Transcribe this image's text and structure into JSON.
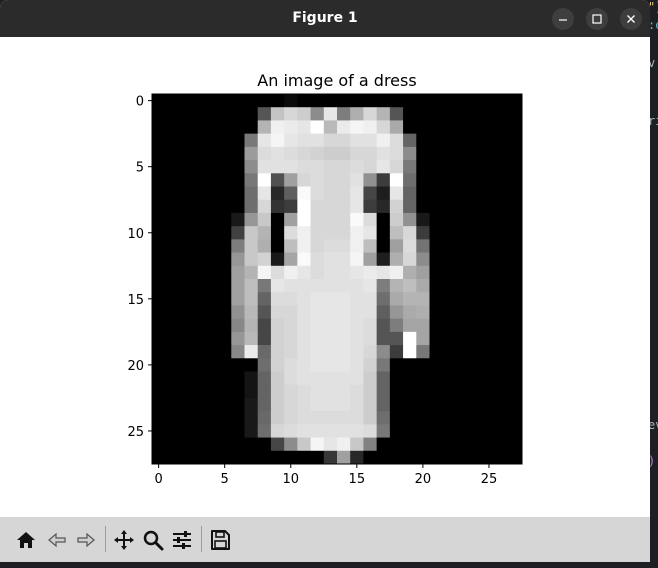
{
  "window": {
    "title": "Figure 1"
  },
  "background_fragments": [
    "\")",
    ":e",
    "v",
    "ri",
    "ev",
    ")"
  ],
  "figure": {
    "chart_data": {
      "type": "heatmap",
      "title": "An image of a dress",
      "colormap": "gray",
      "xlim": [
        -0.5,
        27.5
      ],
      "ylim": [
        27.5,
        -0.5
      ],
      "xticks": [
        0,
        5,
        10,
        15,
        20,
        25
      ],
      "yticks": [
        0,
        5,
        10,
        15,
        20,
        25
      ],
      "rows": [
        [
          0,
          0,
          0,
          0,
          0,
          0,
          0,
          0,
          0,
          0,
          10,
          0,
          0,
          0,
          0,
          0,
          0,
          0,
          0,
          0,
          0,
          0,
          0,
          0,
          0,
          0,
          0,
          0
        ],
        [
          0,
          0,
          0,
          0,
          0,
          0,
          0,
          0,
          85,
          195,
          215,
          205,
          140,
          230,
          125,
          175,
          215,
          180,
          85,
          0,
          0,
          0,
          0,
          0,
          0,
          0,
          0,
          0
        ],
        [
          0,
          0,
          0,
          0,
          0,
          0,
          0,
          0,
          180,
          240,
          235,
          230,
          255,
          185,
          235,
          245,
          240,
          215,
          170,
          0,
          0,
          0,
          0,
          0,
          0,
          0,
          0,
          0
        ],
        [
          0,
          0,
          0,
          0,
          0,
          0,
          0,
          120,
          230,
          245,
          230,
          225,
          225,
          215,
          215,
          225,
          225,
          240,
          220,
          100,
          0,
          0,
          0,
          0,
          0,
          0,
          0,
          0
        ],
        [
          0,
          0,
          0,
          0,
          0,
          0,
          0,
          155,
          220,
          225,
          220,
          215,
          210,
          205,
          205,
          215,
          215,
          225,
          220,
          140,
          0,
          0,
          0,
          0,
          0,
          0,
          0,
          0
        ],
        [
          0,
          0,
          0,
          0,
          0,
          0,
          0,
          140,
          225,
          225,
          225,
          220,
          220,
          215,
          215,
          220,
          215,
          230,
          215,
          120,
          0,
          0,
          0,
          0,
          0,
          0,
          0,
          0
        ],
        [
          0,
          0,
          0,
          0,
          0,
          0,
          0,
          120,
          255,
          80,
          160,
          215,
          220,
          215,
          215,
          225,
          145,
          60,
          255,
          110,
          0,
          0,
          0,
          0,
          0,
          0,
          0,
          0
        ],
        [
          0,
          0,
          0,
          0,
          0,
          0,
          0,
          110,
          230,
          40,
          95,
          250,
          220,
          215,
          215,
          230,
          70,
          30,
          230,
          100,
          0,
          0,
          0,
          0,
          0,
          0,
          0,
          0
        ],
        [
          0,
          0,
          0,
          0,
          0,
          0,
          0,
          110,
          215,
          50,
          60,
          255,
          215,
          215,
          215,
          230,
          60,
          40,
          210,
          100,
          0,
          0,
          0,
          0,
          0,
          0,
          0,
          0
        ],
        [
          0,
          0,
          0,
          0,
          0,
          0,
          25,
          150,
          200,
          0,
          160,
          255,
          215,
          215,
          215,
          250,
          220,
          0,
          205,
          145,
          25,
          0,
          0,
          0,
          0,
          0,
          0,
          0
        ],
        [
          0,
          0,
          0,
          0,
          0,
          0,
          65,
          200,
          180,
          0,
          220,
          240,
          215,
          215,
          215,
          240,
          230,
          0,
          190,
          215,
          60,
          0,
          0,
          0,
          0,
          0,
          0,
          0
        ],
        [
          0,
          0,
          0,
          0,
          0,
          0,
          125,
          200,
          175,
          0,
          190,
          240,
          215,
          220,
          220,
          240,
          190,
          0,
          160,
          220,
          115,
          0,
          0,
          0,
          0,
          0,
          0,
          0
        ],
        [
          0,
          0,
          0,
          0,
          0,
          0,
          150,
          200,
          210,
          25,
          165,
          250,
          220,
          225,
          225,
          245,
          160,
          30,
          175,
          215,
          140,
          0,
          0,
          0,
          0,
          0,
          0,
          0
        ],
        [
          0,
          0,
          0,
          0,
          0,
          0,
          160,
          180,
          245,
          220,
          240,
          230,
          220,
          225,
          225,
          230,
          235,
          230,
          240,
          175,
          160,
          0,
          0,
          0,
          0,
          0,
          0,
          0
        ],
        [
          0,
          0,
          0,
          0,
          0,
          0,
          160,
          190,
          120,
          230,
          225,
          225,
          225,
          225,
          225,
          225,
          230,
          125,
          180,
          190,
          170,
          0,
          0,
          0,
          0,
          0,
          0,
          0
        ],
        [
          0,
          0,
          0,
          0,
          0,
          0,
          160,
          190,
          100,
          220,
          220,
          225,
          230,
          230,
          230,
          225,
          225,
          110,
          170,
          180,
          180,
          0,
          0,
          0,
          0,
          0,
          0,
          0
        ],
        [
          0,
          0,
          0,
          0,
          0,
          0,
          145,
          185,
          85,
          215,
          215,
          225,
          230,
          230,
          230,
          225,
          225,
          95,
          150,
          170,
          175,
          0,
          0,
          0,
          0,
          0,
          0,
          0
        ],
        [
          0,
          0,
          0,
          0,
          0,
          0,
          135,
          180,
          70,
          210,
          215,
          225,
          230,
          230,
          230,
          225,
          220,
          85,
          125,
          165,
          165,
          0,
          0,
          0,
          0,
          0,
          0,
          0
        ],
        [
          0,
          0,
          0,
          0,
          0,
          0,
          150,
          185,
          70,
          210,
          215,
          225,
          230,
          230,
          230,
          225,
          220,
          85,
          85,
          255,
          165,
          0,
          0,
          0,
          0,
          0,
          0,
          0
        ],
        [
          0,
          0,
          0,
          0,
          0,
          0,
          135,
          235,
          105,
          210,
          215,
          225,
          230,
          230,
          230,
          225,
          215,
          140,
          60,
          255,
          120,
          0,
          0,
          0,
          0,
          0,
          0,
          0
        ],
        [
          0,
          0,
          0,
          0,
          0,
          0,
          0,
          0,
          110,
          210,
          220,
          225,
          230,
          230,
          230,
          225,
          210,
          120,
          0,
          0,
          0,
          0,
          0,
          0,
          0,
          0,
          0,
          0
        ],
        [
          0,
          0,
          0,
          0,
          0,
          0,
          0,
          20,
          100,
          205,
          220,
          225,
          225,
          225,
          225,
          225,
          205,
          100,
          0,
          0,
          0,
          0,
          0,
          0,
          0,
          0,
          0,
          0
        ],
        [
          0,
          0,
          0,
          0,
          0,
          0,
          0,
          20,
          100,
          205,
          215,
          220,
          225,
          225,
          225,
          220,
          205,
          100,
          0,
          0,
          0,
          0,
          0,
          0,
          0,
          0,
          0,
          0
        ],
        [
          0,
          0,
          0,
          0,
          0,
          0,
          0,
          25,
          100,
          205,
          215,
          220,
          225,
          225,
          225,
          220,
          205,
          100,
          0,
          0,
          0,
          0,
          0,
          0,
          0,
          0,
          0,
          0
        ],
        [
          0,
          0,
          0,
          0,
          0,
          0,
          0,
          25,
          105,
          205,
          215,
          220,
          220,
          220,
          220,
          220,
          205,
          110,
          0,
          0,
          0,
          0,
          0,
          0,
          0,
          0,
          0,
          0
        ],
        [
          0,
          0,
          0,
          0,
          0,
          0,
          0,
          25,
          110,
          215,
          220,
          225,
          225,
          225,
          225,
          225,
          220,
          120,
          0,
          0,
          0,
          0,
          0,
          0,
          0,
          0,
          0,
          0
        ],
        [
          0,
          0,
          0,
          0,
          0,
          0,
          0,
          0,
          0,
          70,
          140,
          200,
          245,
          230,
          240,
          200,
          130,
          0,
          0,
          0,
          0,
          0,
          0,
          0,
          0,
          0,
          0,
          0
        ],
        [
          0,
          0,
          0,
          0,
          0,
          0,
          0,
          0,
          0,
          0,
          0,
          0,
          0,
          55,
          160,
          40,
          0,
          0,
          0,
          0,
          0,
          0,
          0,
          0,
          0,
          0,
          0,
          0
        ]
      ]
    }
  },
  "toolbar": {
    "buttons": [
      {
        "name": "home-icon"
      },
      {
        "name": "back-icon"
      },
      {
        "name": "forward-icon"
      },
      {
        "name": "pan-icon"
      },
      {
        "name": "zoom-icon"
      },
      {
        "name": "configure-subplots-icon"
      },
      {
        "name": "save-icon"
      }
    ]
  },
  "colors": {
    "titlebar": "#2b2b2b",
    "toolbar": "#d6d6d6",
    "canvas": "#ffffff",
    "editor_bg": "#1e1f24"
  }
}
